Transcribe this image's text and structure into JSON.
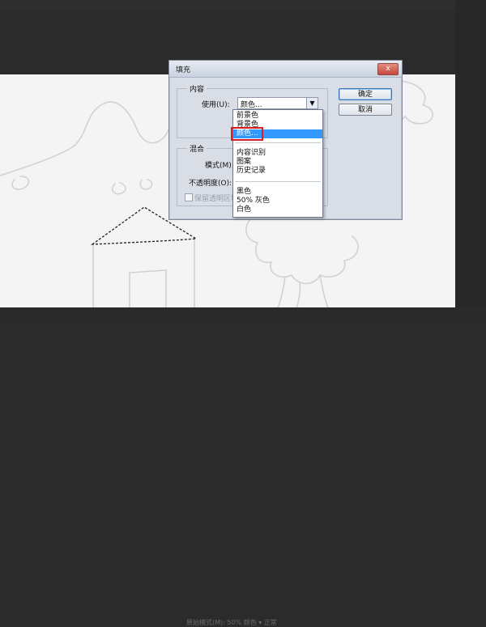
{
  "dialog": {
    "title": "填充",
    "close_label": "x",
    "content_group": "内容",
    "use_label": "使用(U):",
    "use_value": "颜色...",
    "blend_group": "混合",
    "mode_label": "模式(M):",
    "opacity_label": "不透明度(O):",
    "preserve_label": "保留透明区域",
    "ok_label": "确定",
    "cancel_label": "取消"
  },
  "dropdown": {
    "items": [
      {
        "label": "前景色"
      },
      {
        "label": "背景色"
      },
      {
        "label": "颜色..."
      },
      {
        "label": "内容识别"
      },
      {
        "label": "图案"
      },
      {
        "label": "历史记录"
      },
      {
        "label": "黑色"
      },
      {
        "label": "50% 灰色"
      },
      {
        "label": "白色"
      }
    ],
    "selected_index": 2,
    "selection_color": "#3399ff",
    "highlight_color": "#d81e1e"
  },
  "status": {
    "text": "原始模式(M): 50% 颜色   ▾   正常"
  }
}
